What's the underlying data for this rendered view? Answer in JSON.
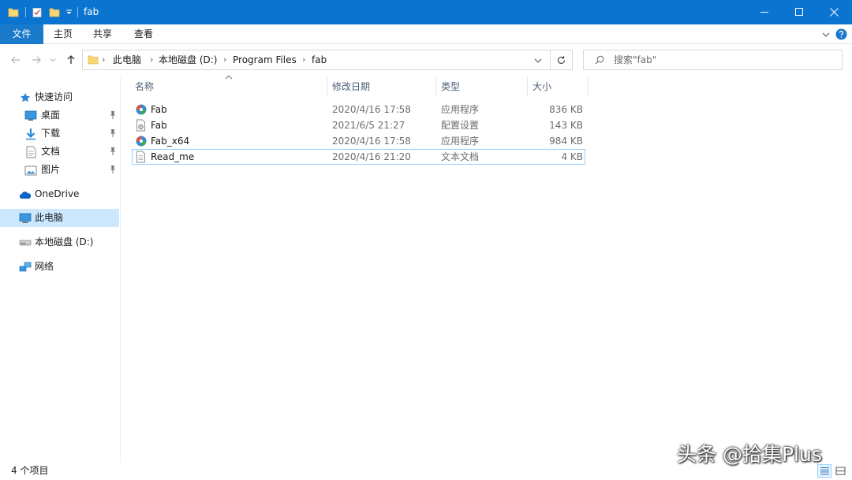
{
  "window": {
    "title": "fab",
    "controls": [
      "minimize-icon",
      "maximize-icon",
      "close-icon"
    ]
  },
  "ribbon": {
    "file_tab": "文件",
    "tabs": [
      "主页",
      "共享",
      "查看"
    ]
  },
  "address": {
    "crumbs": [
      "此电脑",
      "本地磁盘 (D:)",
      "Program Files",
      "fab"
    ]
  },
  "search": {
    "placeholder": "搜索\"fab\""
  },
  "sidebar": {
    "quick_access": "快速访问",
    "quick_items": [
      {
        "label": "桌面",
        "icon": "desktop-icon"
      },
      {
        "label": "下载",
        "icon": "download-icon"
      },
      {
        "label": "文档",
        "icon": "document-icon"
      },
      {
        "label": "图片",
        "icon": "picture-icon"
      }
    ],
    "onedrive": "OneDrive",
    "this_pc": "此电脑",
    "local_disk": "本地磁盘 (D:)",
    "network": "网络"
  },
  "columns": {
    "name": "名称",
    "modified": "修改日期",
    "type": "类型",
    "size": "大小"
  },
  "files": [
    {
      "name": "Fab",
      "modified": "2020/4/16 17:58",
      "type": "应用程序",
      "size": "836 KB",
      "icon": "app-icon"
    },
    {
      "name": "Fab",
      "modified": "2021/6/5 21:27",
      "type": "配置设置",
      "size": "143 KB",
      "icon": "config-file-icon"
    },
    {
      "name": "Fab_x64",
      "modified": "2020/4/16 17:58",
      "type": "应用程序",
      "size": "984 KB",
      "icon": "app-icon"
    },
    {
      "name": "Read_me",
      "modified": "2020/4/16 21:20",
      "type": "文本文档",
      "size": "4 KB",
      "icon": "text-file-icon"
    }
  ],
  "status": {
    "count": "4 个项目"
  },
  "watermark": "头条 @拾集Plus",
  "colors": {
    "titlebar": "#0b74d0",
    "file_tab": "#1979ca",
    "selected_nav": "#cce8ff",
    "focus_border": "#99d1ff"
  }
}
